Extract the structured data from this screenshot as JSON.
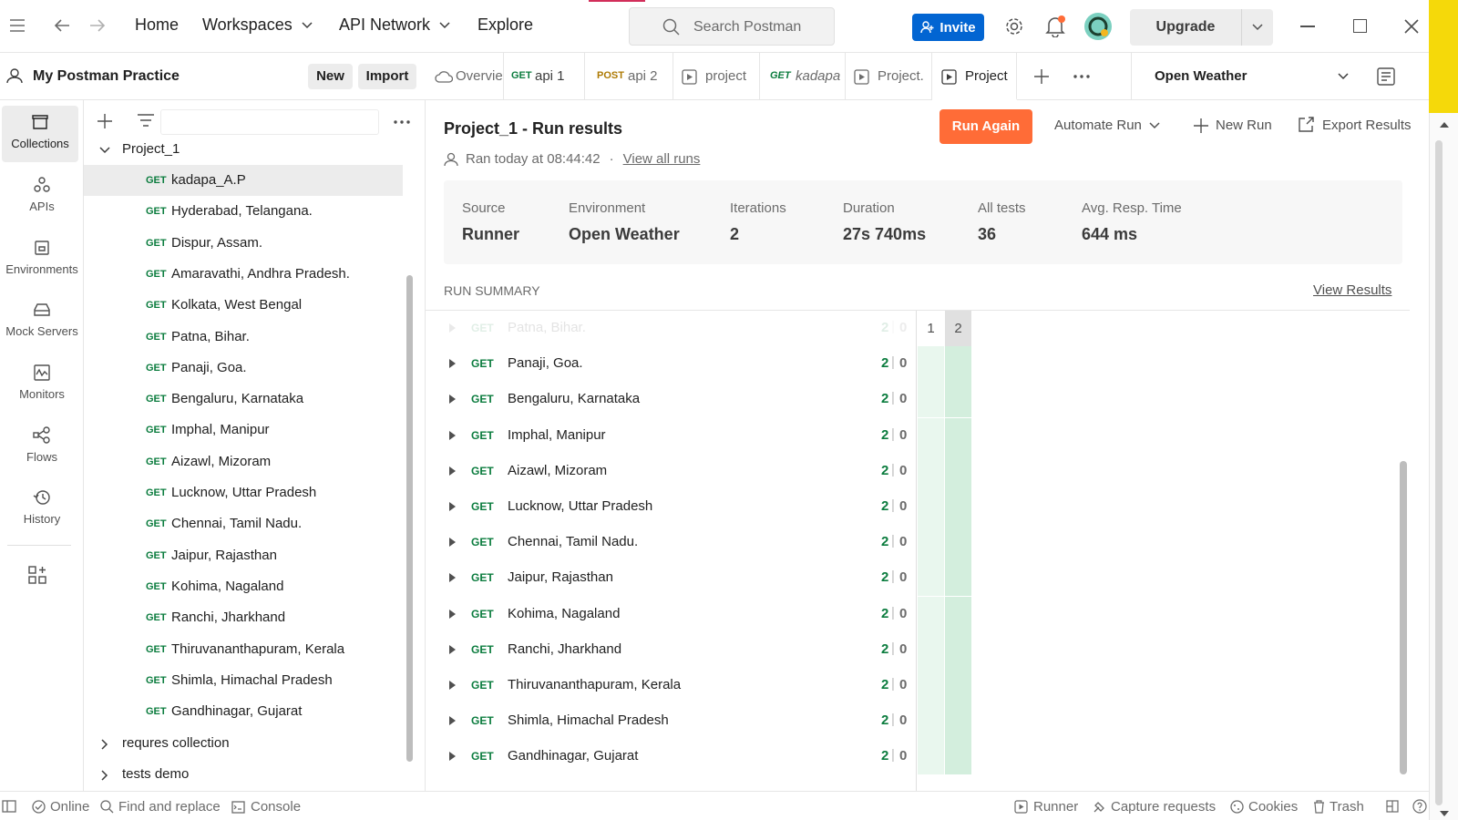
{
  "topbar": {
    "nav": [
      "Home",
      "Workspaces",
      "API Network",
      "Explore"
    ],
    "search_placeholder": "Search Postman",
    "invite_label": "Invite",
    "upgrade_label": "Upgrade"
  },
  "rail": {
    "items": [
      {
        "label": "Collections",
        "icon": "collections-icon"
      },
      {
        "label": "APIs",
        "icon": "apis-icon"
      },
      {
        "label": "Environments",
        "icon": "environments-icon"
      },
      {
        "label": "Mock Servers",
        "icon": "mock-servers-icon"
      },
      {
        "label": "Monitors",
        "icon": "monitors-icon"
      },
      {
        "label": "Flows",
        "icon": "flows-icon"
      },
      {
        "label": "History",
        "icon": "history-icon"
      }
    ]
  },
  "workspace": {
    "name": "My Postman Practice",
    "new_label": "New",
    "import_label": "Import"
  },
  "tree": {
    "collection": "Project_1",
    "requests": [
      {
        "method": "GET",
        "name": "kadapa_A.P"
      },
      {
        "method": "GET",
        "name": "Hyderabad, Telangana."
      },
      {
        "method": "GET",
        "name": "Dispur, Assam."
      },
      {
        "method": "GET",
        "name": "Amaravathi, Andhra Pradesh."
      },
      {
        "method": "GET",
        "name": "Kolkata, West Bengal"
      },
      {
        "method": "GET",
        "name": "Patna, Bihar."
      },
      {
        "method": "GET",
        "name": "Panaji, Goa."
      },
      {
        "method": "GET",
        "name": "Bengaluru, Karnataka"
      },
      {
        "method": "GET",
        "name": "Imphal, Manipur"
      },
      {
        "method": "GET",
        "name": "Aizawl, Mizoram"
      },
      {
        "method": "GET",
        "name": "Lucknow, Uttar Pradesh"
      },
      {
        "method": "GET",
        "name": "Chennai, Tamil Nadu."
      },
      {
        "method": "GET",
        "name": "Jaipur, Rajasthan"
      },
      {
        "method": "GET",
        "name": "Kohima, Nagaland"
      },
      {
        "method": "GET",
        "name": "Ranchi, Jharkhand"
      },
      {
        "method": "GET",
        "name": "Thiruvananthapuram, Kerala"
      },
      {
        "method": "GET",
        "name": "Shimla, Himachal Pradesh"
      },
      {
        "method": "GET",
        "name": "Gandhinagar, Gujarat"
      }
    ],
    "other_collections": [
      "requres collection",
      "tests demo"
    ]
  },
  "tabs": [
    {
      "method": "",
      "label": "Overvie"
    },
    {
      "method": "GET",
      "label": "api 1"
    },
    {
      "method": "POST",
      "label": "api 2"
    },
    {
      "method": "",
      "label": "project"
    },
    {
      "method": "GET",
      "label": "kadapa"
    },
    {
      "method": "",
      "label": "Project."
    },
    {
      "method": "",
      "label": "Project"
    }
  ],
  "environment": "Open Weather",
  "run": {
    "title": "Project_1 - Run results",
    "ran_at": "Ran today at 08:44:42",
    "view_all_runs": "View all runs",
    "run_again_label": "Run Again",
    "automate_label": "Automate Run",
    "new_run_label": "New Run",
    "export_label": "Export Results",
    "stats": [
      {
        "key": "Source",
        "value": "Runner"
      },
      {
        "key": "Environment",
        "value": "Open Weather"
      },
      {
        "key": "Iterations",
        "value": "2"
      },
      {
        "key": "Duration",
        "value": "27s 740ms"
      },
      {
        "key": "All tests",
        "value": "36"
      },
      {
        "key": "Avg. Resp. Time",
        "value": "644 ms"
      }
    ],
    "summary_heading": "RUN SUMMARY",
    "view_results": "View Results",
    "iteration_headers": [
      "1",
      "2"
    ],
    "faded_row": {
      "method": "GET",
      "name": "Patna, Bihar.",
      "passed": "2",
      "failed": "0"
    },
    "rows": [
      {
        "method": "GET",
        "name": "Panaji, Goa.",
        "passed": "2",
        "failed": "0"
      },
      {
        "method": "GET",
        "name": "Bengaluru, Karnataka",
        "passed": "2",
        "failed": "0"
      },
      {
        "method": "GET",
        "name": "Imphal, Manipur",
        "passed": "2",
        "failed": "0"
      },
      {
        "method": "GET",
        "name": "Aizawl, Mizoram",
        "passed": "2",
        "failed": "0"
      },
      {
        "method": "GET",
        "name": "Lucknow, Uttar Pradesh",
        "passed": "2",
        "failed": "0"
      },
      {
        "method": "GET",
        "name": "Chennai, Tamil Nadu.",
        "passed": "2",
        "failed": "0"
      },
      {
        "method": "GET",
        "name": "Jaipur, Rajasthan",
        "passed": "2",
        "failed": "0"
      },
      {
        "method": "GET",
        "name": "Kohima, Nagaland",
        "passed": "2",
        "failed": "0"
      },
      {
        "method": "GET",
        "name": "Ranchi, Jharkhand",
        "passed": "2",
        "failed": "0"
      },
      {
        "method": "GET",
        "name": "Thiruvananthapuram, Kerala",
        "passed": "2",
        "failed": "0"
      },
      {
        "method": "GET",
        "name": "Shimla, Himachal Pradesh",
        "passed": "2",
        "failed": "0"
      },
      {
        "method": "GET",
        "name": "Gandhinagar, Gujarat",
        "passed": "2",
        "failed": "0"
      }
    ]
  },
  "statusbar": {
    "online": "Online",
    "find_replace": "Find and replace",
    "console": "Console",
    "runner": "Runner",
    "capture": "Capture requests",
    "cookies": "Cookies",
    "trash": "Trash"
  },
  "colors": {
    "accent_orange": "#ff6c37",
    "invite_blue": "#0265d2",
    "get_green": "#0b7c3e",
    "post_orange": "#ad7a03"
  }
}
